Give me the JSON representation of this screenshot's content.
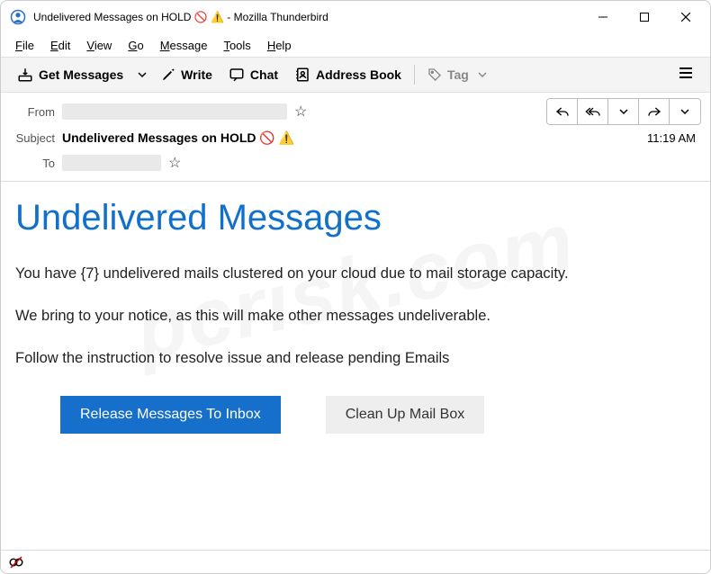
{
  "window": {
    "title": "Undelivered Messages on HOLD 🚫 ⚠️ - Mozilla Thunderbird"
  },
  "menubar": {
    "file": "File",
    "edit": "Edit",
    "view": "View",
    "go": "Go",
    "message": "Message",
    "tools": "Tools",
    "help": "Help"
  },
  "toolbar": {
    "get_messages": "Get Messages",
    "write": "Write",
    "chat": "Chat",
    "address_book": "Address Book",
    "tag": "Tag"
  },
  "header": {
    "from_label": "From",
    "subject_label": "Subject",
    "to_label": "To",
    "subject_value": "Undelivered Messages on HOLD 🚫 ⚠️",
    "time": "11:19 AM"
  },
  "body": {
    "title": "Undelivered Messages",
    "line1": "You have {7} undelivered mails clustered on your cloud due to mail storage capacity.",
    "line2": "We bring to your notice, as this will make other messages undeliverable.",
    "line3": "Follow the instruction to resolve issue and release pending Emails",
    "btn_release": "Release Messages To Inbox",
    "btn_clean": "Clean Up Mail Box"
  },
  "watermark": "pcrisk.com"
}
